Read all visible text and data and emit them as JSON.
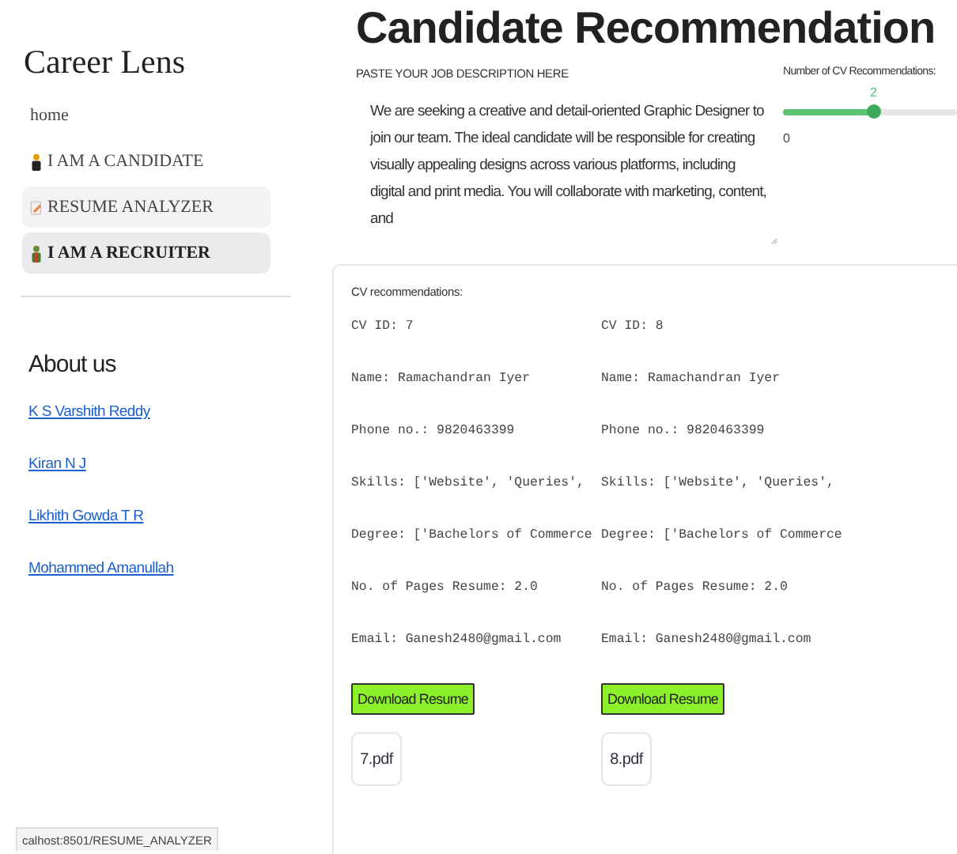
{
  "sidebar": {
    "title": "Career Lens",
    "nav": [
      {
        "label": "home",
        "kind": "plain",
        "selected": false,
        "hovered": false
      },
      {
        "label": "I AM A CANDIDATE",
        "kind": "candidate",
        "selected": false,
        "hovered": false
      },
      {
        "label": "RESUME ANALYZER",
        "kind": "document",
        "selected": false,
        "hovered": true
      },
      {
        "label": "I AM A RECRUITER",
        "kind": "recruiter",
        "selected": true,
        "hovered": false
      }
    ],
    "about_title": "About us",
    "links": [
      "K S Varshith Reddy",
      "Kiran N J",
      "Likhith Gowda T R",
      "Mohammed Amanullah"
    ]
  },
  "status_bar": "calhost:8501/RESUME_ANALYZER",
  "main": {
    "title": "Candidate Recommendation",
    "job_label": "PASTE YOUR JOB DESCRIPTION HERE",
    "job_text": "We are seeking a creative and detail-oriented Graphic Designer to join our team. The ideal candidate will be responsible for creating visually appealing designs across various platforms, including digital and print media. You will collaborate with marketing, content, and",
    "slider": {
      "label": "Number of CV Recommendations:",
      "value": "2",
      "min": "0",
      "level": 0.52
    },
    "results": {
      "label": "CV recommendations:",
      "cvs": [
        {
          "lines": [
            "CV ID: 7",
            "Name: Ramachandran Iyer",
            "Phone no.: 9820463399",
            "Skills: ['Website', 'Queries',",
            "Degree: ['Bachelors of Commerce",
            "No. of Pages Resume: 2.0",
            "Email: Ganesh2480@gmail.com"
          ],
          "button": "Download Resume",
          "file": "7.pdf"
        },
        {
          "lines": [
            "CV ID: 8",
            "Name: Ramachandran Iyer",
            "Phone no.: 9820463399",
            "Skills: ['Website', 'Queries',",
            "Degree: ['Bachelors of Commerce",
            "No. of Pages Resume: 2.0",
            "Email: Ganesh2480@gmail.com"
          ],
          "button": "Download Resume",
          "file": "8.pdf"
        }
      ]
    }
  }
}
